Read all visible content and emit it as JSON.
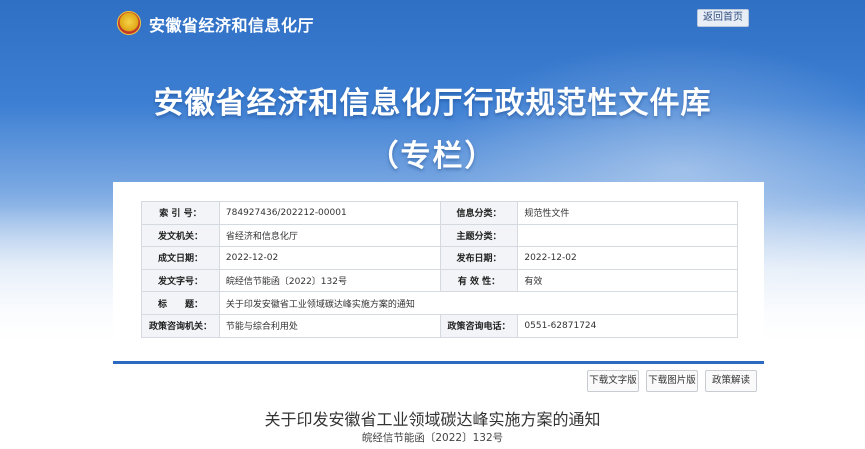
{
  "header": {
    "site_name": "安徽省经济和信息化厅",
    "home_button": "返回首页"
  },
  "banner": {
    "title": "安徽省经济和信息化厅行政规范性文件库",
    "subtitle": "（专栏）"
  },
  "meta": {
    "rows": [
      {
        "l1": "索 引 号：",
        "v1": "784927436/202212-00001",
        "l2": "信息分类：",
        "v2": "规范性文件"
      },
      {
        "l1": "发文机关：",
        "v1": "省经济和信息化厅",
        "l2": "主题分类：",
        "v2": ""
      },
      {
        "l1": "成文日期：",
        "v1": "2022-12-02",
        "l2": "发布日期：",
        "v2": "2022-12-02"
      },
      {
        "l1": "发文字号：",
        "v1": "皖经信节能函〔2022〕132号",
        "l2": "有 效 性：",
        "v2": "有效"
      }
    ],
    "title_row": {
      "label": "标　　题：",
      "value": "关于印发安徽省工业领域碳达峰实施方案的通知"
    },
    "contact_row": {
      "l1": "政策咨询机关：",
      "v1": "节能与综合利用处",
      "l2": "政策咨询电话：",
      "v2": "0551-62871724"
    }
  },
  "actions": {
    "download_text": "下载文字版",
    "download_image": "下载图片版",
    "interpretation": "政策解读"
  },
  "document": {
    "title": "关于印发安徽省工业领域碳达峰实施方案的通知",
    "number": "皖经信节能函〔2022〕132号"
  },
  "colors": {
    "banner_blue": "#2f6fc4",
    "accent_bar": "#2b6ac0"
  },
  "icons": {
    "emblem": "national-emblem-icon"
  }
}
